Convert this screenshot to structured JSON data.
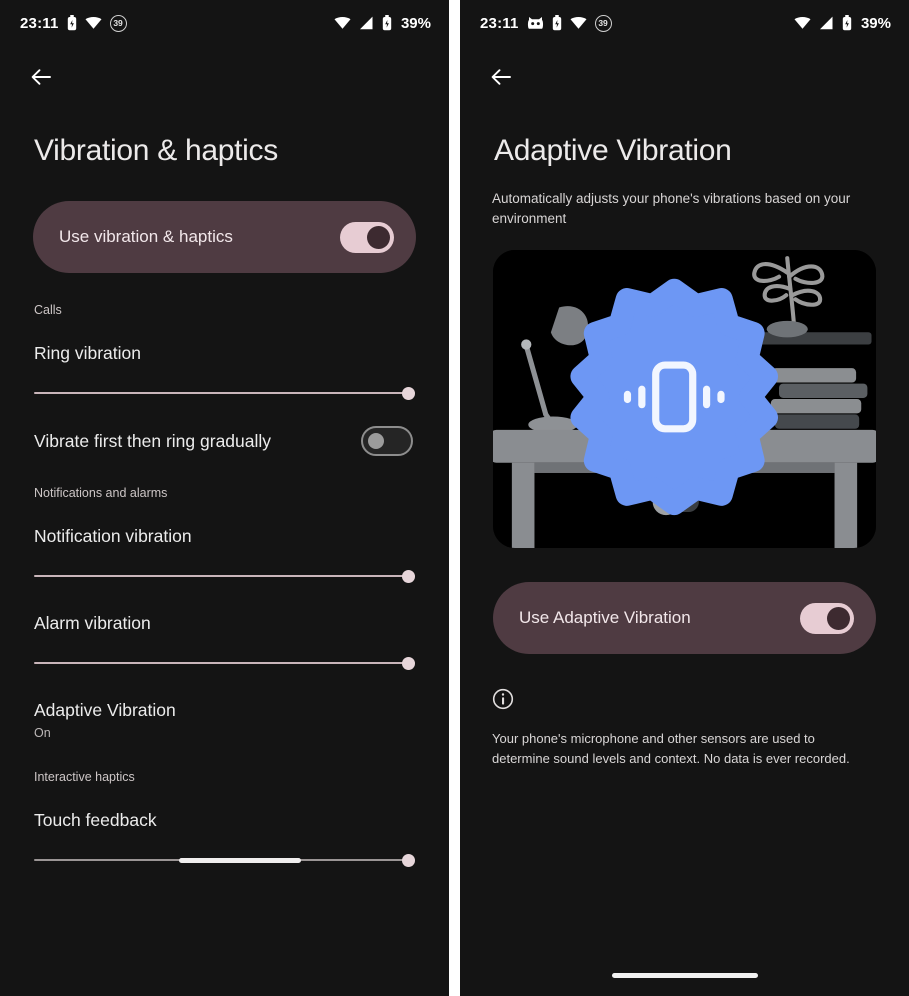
{
  "theme": {
    "background": "#141414",
    "card_accent": "#4f3b42",
    "switch_on_track": "#e7ccd3",
    "switch_on_knob": "#3d2a30",
    "slider_track": "#c9b5ba",
    "slider_thumb": "#e7d6da",
    "illustration_blue": "#6d97f4",
    "text_primary": "#ececec",
    "text_secondary": "#bdb8b8"
  },
  "left_panel": {
    "status_bar": {
      "time": "23:11",
      "battery_percent": "39%",
      "notification_badge": "39",
      "left_icons": [
        "battery-saver-icon",
        "wifi-icon",
        "dnd-badge-icon"
      ],
      "right_icons": [
        "wifi-icon",
        "cellular-signal-icon",
        "battery-icon"
      ]
    },
    "back_label": "Back",
    "title": "Vibration & haptics",
    "main_toggle": {
      "label": "Use vibration & haptics",
      "state": "on"
    },
    "sections": [
      {
        "header": "Calls",
        "items": [
          {
            "type": "slider",
            "label": "Ring vibration",
            "value": 100
          },
          {
            "type": "toggle",
            "label": "Vibrate first then ring gradually",
            "state": "off"
          }
        ]
      },
      {
        "header": "Notifications and alarms",
        "items": [
          {
            "type": "slider",
            "label": "Notification vibration",
            "value": 100
          },
          {
            "type": "slider",
            "label": "Alarm vibration",
            "value": 100
          },
          {
            "type": "link",
            "label": "Adaptive Vibration",
            "sub": "On"
          }
        ]
      },
      {
        "header": "Interactive haptics",
        "items": [
          {
            "type": "slider",
            "label": "Touch feedback",
            "value": 100,
            "segment_start": 38,
            "segment_end": 70
          }
        ]
      }
    ]
  },
  "right_panel": {
    "status_bar": {
      "time": "23:11",
      "battery_percent": "39%",
      "notification_badge": "39",
      "left_icons": [
        "app-notification-icon",
        "battery-saver-icon",
        "wifi-icon",
        "dnd-badge-icon"
      ],
      "right_icons": [
        "wifi-icon",
        "cellular-signal-icon",
        "battery-icon"
      ]
    },
    "back_label": "Back",
    "title": "Adaptive Vibration",
    "description": "Automatically adjusts your phone's vibrations based on your environment",
    "illustration": {
      "name": "desk-with-vibrating-phone-illustration",
      "elements": [
        "desk",
        "desk-lamp",
        "shelf",
        "potted-plant",
        "book-stack",
        "blue-starburst",
        "phone-vibrate-icon",
        "toggle-switch"
      ]
    },
    "main_toggle": {
      "label": "Use Adaptive Vibration",
      "state": "on"
    },
    "info_icon": "info-circle-icon",
    "note": "Your phone's microphone and other sensors are used to determine sound levels and context. No data is ever recorded."
  }
}
